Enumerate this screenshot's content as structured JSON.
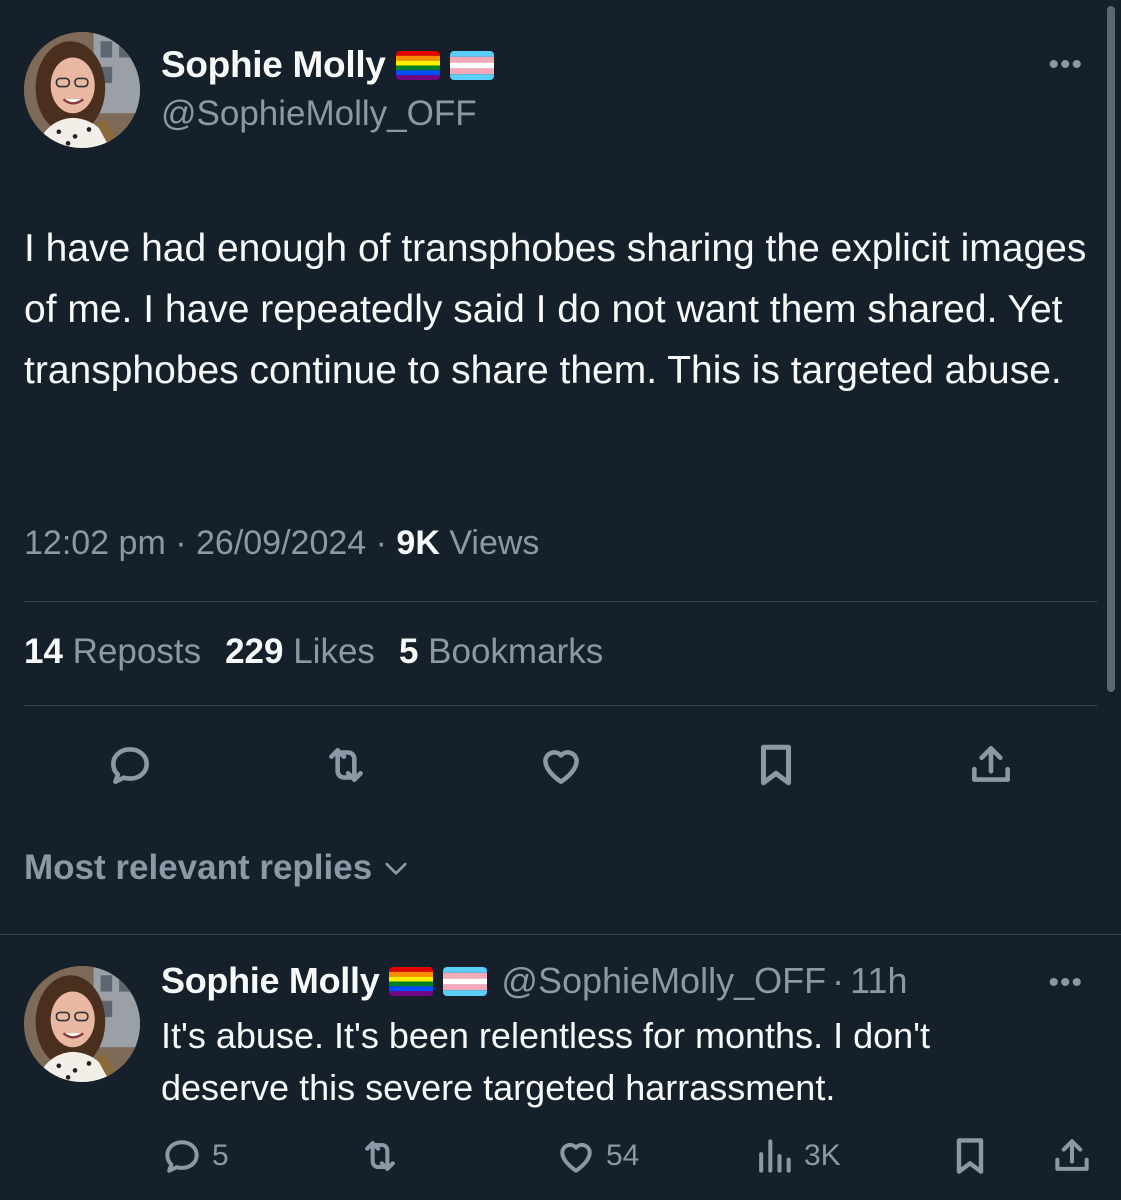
{
  "main_tweet": {
    "author_name": "Sophie Molly",
    "author_handle": "@SophieMolly_OFF",
    "text": "I have had enough of transphobes sharing the explicit images of me. I have repeatedly said I do not want them shared. Yet transphobes continue to share them. This is targeted abuse.",
    "time": "12:02 pm",
    "date": "26/09/2024",
    "views_count": "9K",
    "views_label": "Views",
    "reposts_count": "14",
    "reposts_label": "Reposts",
    "likes_count": "229",
    "likes_label": "Likes",
    "bookmarks_count": "5",
    "bookmarks_label": "Bookmarks",
    "more_icon": "more-icon"
  },
  "replies_filter": {
    "label": "Most relevant replies",
    "icon": "chevron-down-icon"
  },
  "reply": {
    "author_name": "Sophie Molly",
    "author_handle": "@SophieMolly_OFF",
    "age": "11h",
    "text": "It's abuse. It's been relentless for months. I don't deserve this severe targeted harrassment.",
    "reply_count": "5",
    "like_count": "54",
    "view_count": "3K"
  },
  "flags": [
    "rainbow-flag-icon",
    "transgender-flag-icon"
  ],
  "colors": {
    "background": "#15202b",
    "text": "#f7f9f9",
    "muted": "#8b98a5",
    "divider": "#38444d"
  }
}
